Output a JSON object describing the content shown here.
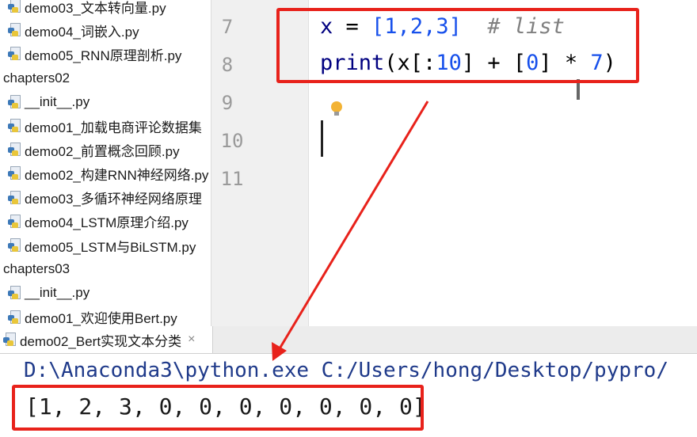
{
  "project_tree": {
    "items": [
      {
        "kind": "file",
        "label": "demo03_文本转向量.py"
      },
      {
        "kind": "file",
        "label": "demo04_词嵌入.py"
      },
      {
        "kind": "file",
        "label": "demo05_RNN原理剖析.py"
      },
      {
        "kind": "folder",
        "label": "chapters02"
      },
      {
        "kind": "file",
        "label": "__init__.py"
      },
      {
        "kind": "file",
        "label": "demo01_加载电商评论数据集"
      },
      {
        "kind": "file",
        "label": "demo02_前置概念回顾.py"
      },
      {
        "kind": "file",
        "label": "demo02_构建RNN神经网络.py"
      },
      {
        "kind": "file",
        "label": "demo03_多循环神经网络原理"
      },
      {
        "kind": "file",
        "label": "demo04_LSTM原理介绍.py"
      },
      {
        "kind": "file",
        "label": "demo05_LSTM与BiLSTM.py"
      },
      {
        "kind": "folder",
        "label": "chapters03"
      },
      {
        "kind": "file",
        "label": "__init__.py"
      },
      {
        "kind": "file",
        "label": "demo01_欢迎使用Bert.py"
      }
    ]
  },
  "editor": {
    "line_numbers": [
      "7",
      "8",
      "9",
      "10",
      "11"
    ],
    "line7": {
      "var": "x",
      "eq": " = ",
      "list": "[1,2,3]",
      "gap": "  ",
      "comment": "# list"
    },
    "line8": {
      "func": "print",
      "open": "(x[:",
      "n10": "10",
      "mid": "] + [",
      "n0": "0",
      "end": "] * ",
      "n7": "7",
      "close": ")"
    }
  },
  "run": {
    "tab_label": "demo02_Bert实现文本分类",
    "tab_close": "×",
    "command": "D:\\Anaconda3\\python.exe C:/Users/hong/Desktop/pypro/",
    "output": "[1, 2, 3, 0, 0, 0, 0, 0, 0, 0]"
  },
  "colors": {
    "highlight": "#e8221b",
    "keyword": "#000080",
    "number": "#1750eb",
    "comment": "#808080"
  }
}
